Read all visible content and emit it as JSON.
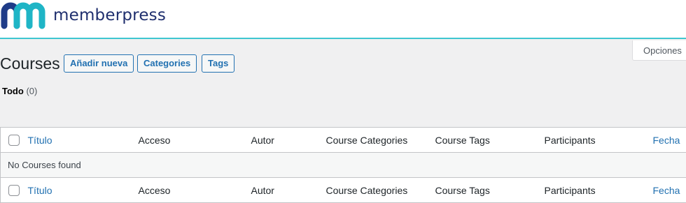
{
  "brand": {
    "name": "memberpress",
    "colors": {
      "mark_dark": "#1f3c88",
      "mark_light": "#1fb5c6",
      "accent_line": "#3ec6d0"
    }
  },
  "screen_options": {
    "label": "Opciones"
  },
  "page": {
    "title": "Courses",
    "buttons": {
      "add_new": "Añadir nueva",
      "categories": "Categories",
      "tags": "Tags"
    }
  },
  "views": {
    "all_label": "Todo",
    "all_count": "(0)"
  },
  "table": {
    "columns": {
      "title": "Título",
      "access": "Acceso",
      "author": "Autor",
      "categories": "Course Categories",
      "tags": "Course Tags",
      "participants": "Participants",
      "date": "Fecha"
    },
    "empty_message": "No Courses found"
  }
}
